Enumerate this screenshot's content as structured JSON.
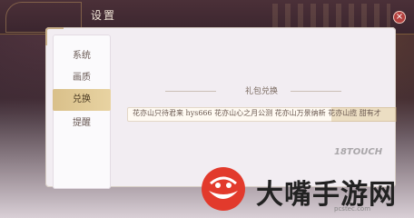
{
  "window": {
    "title": "设置",
    "close_label": "×"
  },
  "sidebar": {
    "items": [
      {
        "label": "系统"
      },
      {
        "label": "画质"
      },
      {
        "label": "兑换"
      },
      {
        "label": "提醒"
      }
    ],
    "active_index": 2
  },
  "redeem": {
    "section_title": "礼包兑换",
    "codes_text": "花亦山只待君来 hys666 花亦山心之月公测 花亦山万景纳新 花亦山揽 甜有才"
  },
  "watermarks": {
    "small": "18TOUCH",
    "brand_text": "大嘴手游网",
    "url": "pcstec.com"
  },
  "colors": {
    "active_tab": "#d9c08a",
    "close_button": "#b3403e",
    "panel_bg": "#f2edf2"
  },
  "icons": {
    "close": "close-icon",
    "watermark": "cartoon-mouth-logo-icon"
  }
}
